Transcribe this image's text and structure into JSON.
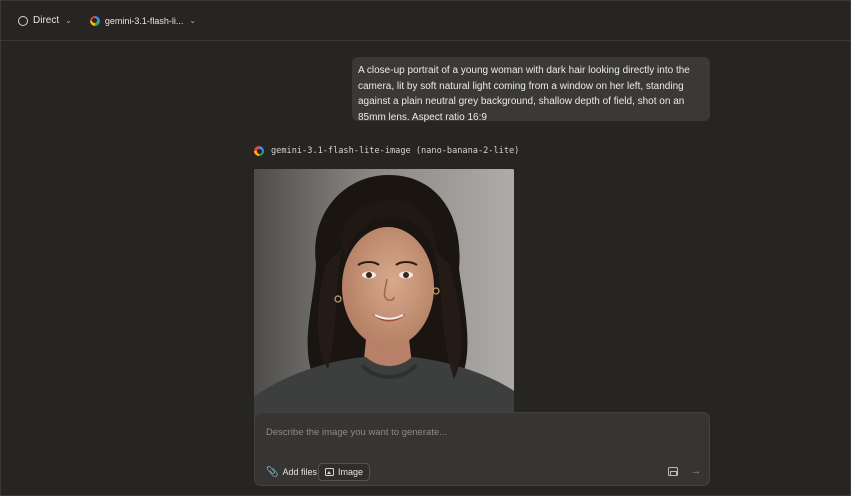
{
  "topbar": {
    "mode_label": "Direct",
    "model_short": "gemini-3.1-flash-li..."
  },
  "conversation": {
    "user_prompt": "A close-up portrait of a young woman with dark hair looking directly into the camera, lit by soft natural light coming from a window on her left, standing against a plain neutral grey background, shallow depth of field, shot on an 85mm lens. Aspect ratio 16:9",
    "model_label": "gemini-3.1-flash-lite-image (nano-banana-2-lite)"
  },
  "composer": {
    "placeholder": "Describe the image you want to generate...",
    "value": "",
    "add_files_label": "Add files",
    "image_label": "Image"
  },
  "icons": {
    "mode": "chat-bubble-icon",
    "provider": "google-g-icon",
    "chevron": "chevron-down-icon",
    "attach": "paperclip-icon",
    "image": "image-icon",
    "aspect": "aspect-ratio-icon",
    "send": "arrow-right-icon"
  },
  "colors": {
    "background": "#262523",
    "bubble": "#3a3937",
    "composer": "#363533"
  }
}
